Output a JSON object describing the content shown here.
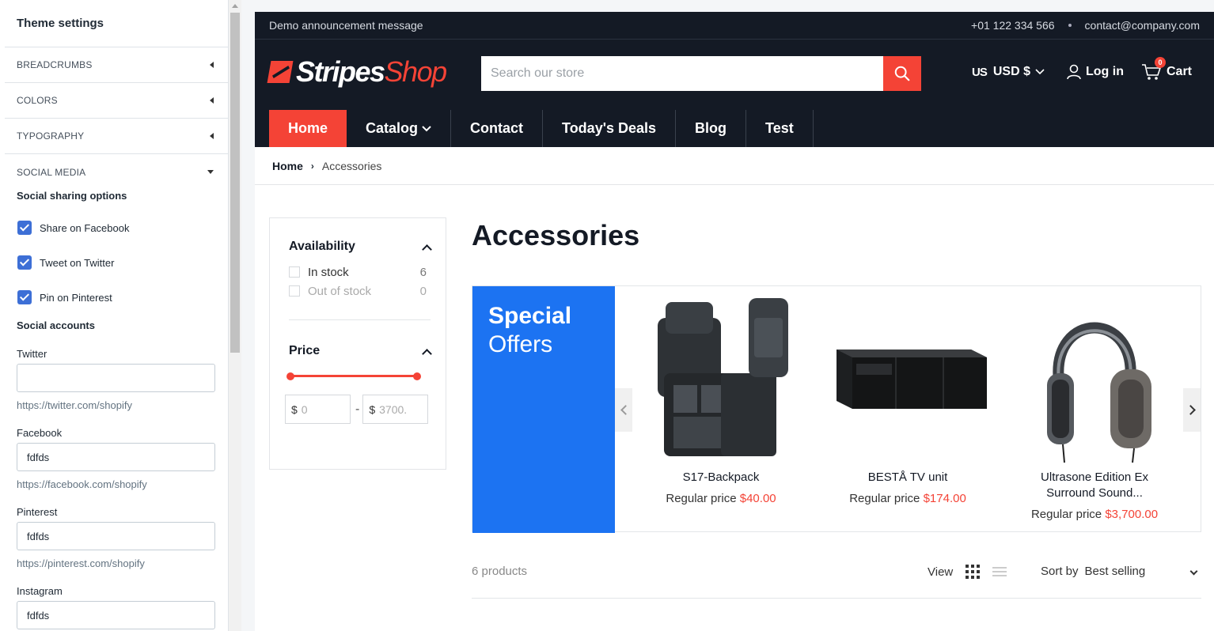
{
  "panel": {
    "title": "Theme settings",
    "sections": [
      "BREADCRUMBS",
      "COLORS",
      "TYPOGRAPHY",
      "SOCIAL MEDIA"
    ],
    "sharing_title": "Social sharing options",
    "checks": [
      "Share on Facebook",
      "Tweet on Twitter",
      "Pin on Pinterest"
    ],
    "accounts_title": "Social accounts",
    "fields": [
      {
        "label": "Twitter",
        "value": "",
        "hint": "https://twitter.com/shopify"
      },
      {
        "label": "Facebook",
        "value": "fdfds",
        "hint": "https://facebook.com/shopify"
      },
      {
        "label": "Pinterest",
        "value": "fdfds",
        "hint": "https://pinterest.com/shopify"
      },
      {
        "label": "Instagram",
        "value": "fdfds"
      }
    ]
  },
  "store": {
    "announcement": "Demo announcement message",
    "phone": "+01 122 334 566",
    "email": "contact@company.com",
    "logo_a": "Stripes",
    "logo_b": "Shop",
    "search_placeholder": "Search our store",
    "currency": "USD $",
    "currency_flag": "US",
    "login": "Log in",
    "cart": "Cart",
    "cart_count": "0",
    "nav": [
      "Home",
      "Catalog",
      "Contact",
      "Today's Deals",
      "Blog",
      "Test"
    ],
    "breadcrumb": {
      "home": "Home",
      "current": "Accessories"
    },
    "filters": {
      "availability": "Availability",
      "in_stock": "In stock",
      "in_stock_n": "6",
      "out_stock": "Out of stock",
      "out_stock_n": "0",
      "price": "Price",
      "currency_sym": "$",
      "min_ph": "0",
      "max_ph": "3700.",
      "dash": "-"
    },
    "title": "Accessories",
    "promo": {
      "line1": "Special",
      "line2": "Offers"
    },
    "products": [
      {
        "name": "S17-Backpack",
        "price_label": "Regular price",
        "price": "$40.00"
      },
      {
        "name": "BESTÅ TV unit",
        "price_label": "Regular price",
        "price": "$174.00"
      },
      {
        "name": "Ultrasone Edition Ex Surround Sound...",
        "price_label": "Regular price",
        "price": "$3,700.00"
      }
    ],
    "toolbar": {
      "count": "6 products",
      "view": "View",
      "sort_label": "Sort by",
      "sort_value": "Best selling"
    }
  },
  "colors": {
    "accent": "#f44336",
    "dark": "#141a25",
    "promo": "#1c73f2",
    "check": "#3d6fd6"
  }
}
